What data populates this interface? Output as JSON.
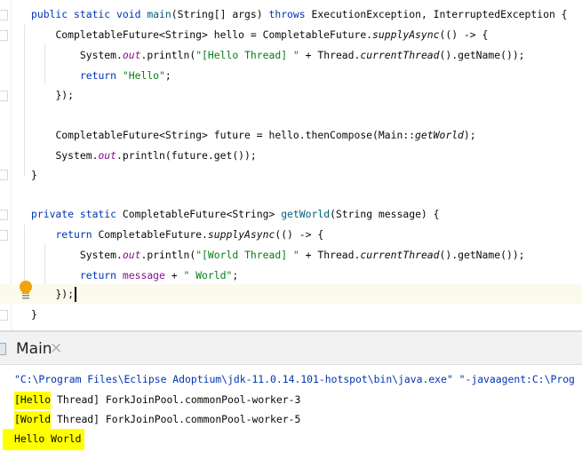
{
  "editor": {
    "lines": [
      {
        "indent": 1,
        "tokens": [
          [
            "public static void ",
            "kw"
          ],
          [
            "main",
            "decl"
          ],
          [
            "(String[] args) ",
            ""
          ],
          [
            "throws",
            "kw"
          ],
          [
            " ExecutionException, InterruptedException {",
            ""
          ]
        ]
      },
      {
        "indent": 2,
        "tokens": [
          [
            "CompletableFuture<String> hello = CompletableFuture.",
            ""
          ],
          [
            "supplyAsync",
            "it"
          ],
          [
            "(() -> {",
            ""
          ]
        ]
      },
      {
        "indent": 3,
        "tokens": [
          [
            "System.",
            ""
          ],
          [
            "out",
            "fld"
          ],
          [
            ".println(",
            ""
          ],
          [
            "\"[Hello Thread] \"",
            "str"
          ],
          [
            " + Thread.",
            ""
          ],
          [
            "currentThread",
            "it"
          ],
          [
            "().getName());",
            ""
          ]
        ]
      },
      {
        "indent": 3,
        "tokens": [
          [
            "return ",
            "kw"
          ],
          [
            "\"Hello\"",
            "str"
          ],
          [
            ";",
            ""
          ]
        ]
      },
      {
        "indent": 2,
        "tokens": [
          [
            "});",
            ""
          ]
        ]
      },
      {
        "indent": 0,
        "tokens": []
      },
      {
        "indent": 2,
        "tokens": [
          [
            "CompletableFuture<String> future = hello.thenCompose(Main::",
            ""
          ],
          [
            "getWorld",
            "it"
          ],
          [
            ");",
            ""
          ]
        ]
      },
      {
        "indent": 2,
        "tokens": [
          [
            "System.",
            ""
          ],
          [
            "out",
            "fld"
          ],
          [
            ".println(future.get());",
            ""
          ]
        ]
      },
      {
        "indent": 1,
        "tokens": [
          [
            "}",
            ""
          ]
        ]
      },
      {
        "indent": 0,
        "tokens": []
      },
      {
        "indent": 1,
        "tokens": [
          [
            "private static ",
            "kw"
          ],
          [
            "CompletableFuture<String> ",
            ""
          ],
          [
            "getWorld",
            "decl"
          ],
          [
            "(String message) {",
            ""
          ]
        ]
      },
      {
        "indent": 2,
        "tokens": [
          [
            "return ",
            "kw"
          ],
          [
            "CompletableFuture.",
            ""
          ],
          [
            "supplyAsync",
            "it"
          ],
          [
            "(() -> {",
            ""
          ]
        ]
      },
      {
        "indent": 3,
        "tokens": [
          [
            "System.",
            ""
          ],
          [
            "out",
            "fld"
          ],
          [
            ".println(",
            ""
          ],
          [
            "\"[World Thread] \"",
            "str"
          ],
          [
            " + Thread.",
            ""
          ],
          [
            "currentThread",
            "it"
          ],
          [
            "().getName());",
            ""
          ]
        ]
      },
      {
        "indent": 3,
        "tokens": [
          [
            "return ",
            "kw"
          ],
          [
            "message",
            "var"
          ],
          [
            " + ",
            ""
          ],
          [
            "\" World\"",
            "str"
          ],
          [
            ";",
            ""
          ]
        ]
      },
      {
        "indent": 2,
        "tokens": [
          [
            "});",
            ""
          ]
        ],
        "current": true
      },
      {
        "indent": 1,
        "tokens": [
          [
            "}",
            ""
          ]
        ]
      }
    ],
    "intention_icon": "lightbulb-icon"
  },
  "run_panel": {
    "tab_label": "Main",
    "close_icon": "×",
    "command": "\"C:\\Program Files\\Eclipse Adoptium\\jdk-11.0.14.101-hotspot\\bin\\java.exe\" \"-javaagent:C:\\Prog",
    "output": [
      {
        "highlight": "[Hello",
        "rest": " Thread] ForkJoinPool.commonPool-worker-3"
      },
      {
        "highlight": "[World",
        "rest": " Thread] ForkJoinPool.commonPool-worker-5"
      },
      {
        "highlight": "Hello World",
        "rest": ""
      }
    ],
    "highlight_color": "#ffff00"
  }
}
